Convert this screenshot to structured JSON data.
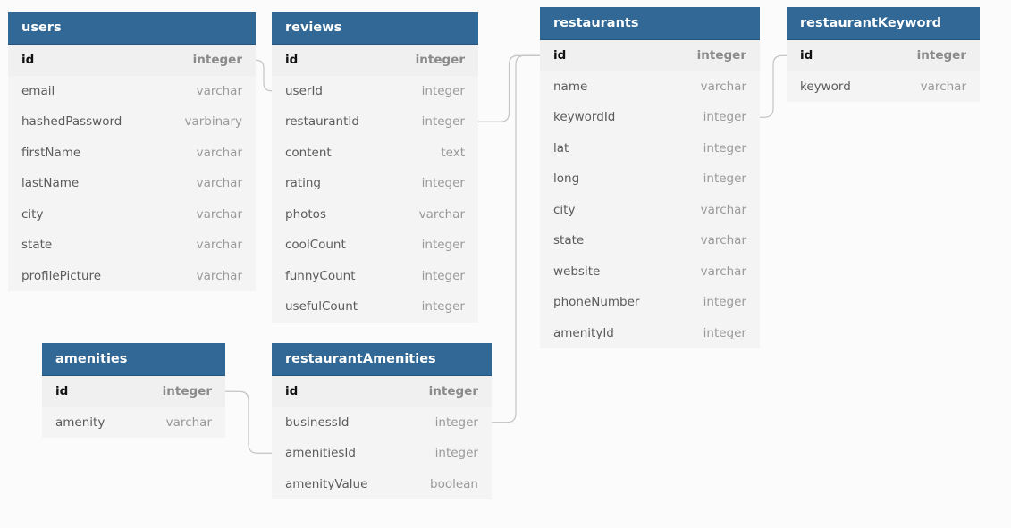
{
  "colors": {
    "header_bg": "#316896",
    "header_text": "#ffffff",
    "body_bg": "#f4f4f4",
    "canvas_bg": "#fbfbfb",
    "connector": "#c4c4c4",
    "field_text": "#5b5b5b",
    "type_text": "#9a9a9a"
  },
  "tables": [
    {
      "key": "users",
      "name": "users",
      "columns": [
        {
          "name": "id",
          "type": "integer",
          "pk": true
        },
        {
          "name": "email",
          "type": "varchar"
        },
        {
          "name": "hashedPassword",
          "type": "varbinary"
        },
        {
          "name": "firstName",
          "type": "varchar"
        },
        {
          "name": "lastName",
          "type": "varchar"
        },
        {
          "name": "city",
          "type": "varchar"
        },
        {
          "name": "state",
          "type": "varchar"
        },
        {
          "name": "profilePicture",
          "type": "varchar"
        }
      ]
    },
    {
      "key": "reviews",
      "name": "reviews",
      "columns": [
        {
          "name": "id",
          "type": "integer",
          "pk": true
        },
        {
          "name": "userId",
          "type": "integer"
        },
        {
          "name": "restaurantId",
          "type": "integer"
        },
        {
          "name": "content",
          "type": "text"
        },
        {
          "name": "rating",
          "type": "integer"
        },
        {
          "name": "photos",
          "type": "varchar"
        },
        {
          "name": "coolCount",
          "type": "integer"
        },
        {
          "name": "funnyCount",
          "type": "integer"
        },
        {
          "name": "usefulCount",
          "type": "integer"
        }
      ]
    },
    {
      "key": "restaurants",
      "name": "restaurants",
      "columns": [
        {
          "name": "id",
          "type": "integer",
          "pk": true
        },
        {
          "name": "name",
          "type": "varchar"
        },
        {
          "name": "keywordId",
          "type": "integer"
        },
        {
          "name": "lat",
          "type": "integer"
        },
        {
          "name": "long",
          "type": "integer"
        },
        {
          "name": "city",
          "type": "varchar"
        },
        {
          "name": "state",
          "type": "varchar"
        },
        {
          "name": "website",
          "type": "varchar"
        },
        {
          "name": "phoneNumber",
          "type": "integer"
        },
        {
          "name": "amenityId",
          "type": "integer"
        }
      ]
    },
    {
      "key": "restaurantKeyword",
      "name": "restaurantKeyword",
      "columns": [
        {
          "name": "id",
          "type": "integer",
          "pk": true
        },
        {
          "name": "keyword",
          "type": "varchar"
        }
      ]
    },
    {
      "key": "amenities",
      "name": "amenities",
      "columns": [
        {
          "name": "id",
          "type": "integer",
          "pk": true
        },
        {
          "name": "amenity",
          "type": "varchar"
        }
      ]
    },
    {
      "key": "restaurantAmenities",
      "name": "restaurantAmenities",
      "columns": [
        {
          "name": "id",
          "type": "integer",
          "pk": true
        },
        {
          "name": "businessId",
          "type": "integer"
        },
        {
          "name": "amenitiesId",
          "type": "integer"
        },
        {
          "name": "amenityValue",
          "type": "boolean"
        }
      ]
    }
  ],
  "relations": [
    {
      "from_table": "users",
      "from_column": "id",
      "to_table": "reviews",
      "to_column": "userId"
    },
    {
      "from_table": "reviews",
      "from_column": "restaurantId",
      "to_table": "restaurants",
      "to_column": "id"
    },
    {
      "from_table": "restaurants",
      "from_column": "keywordId",
      "to_table": "restaurantKeyword",
      "to_column": "id"
    },
    {
      "from_table": "amenities",
      "from_column": "id",
      "to_table": "restaurantAmenities",
      "to_column": "amenitiesId"
    },
    {
      "from_table": "restaurantAmenities",
      "from_column": "businessId",
      "to_table": "restaurants",
      "to_column": "id"
    }
  ]
}
